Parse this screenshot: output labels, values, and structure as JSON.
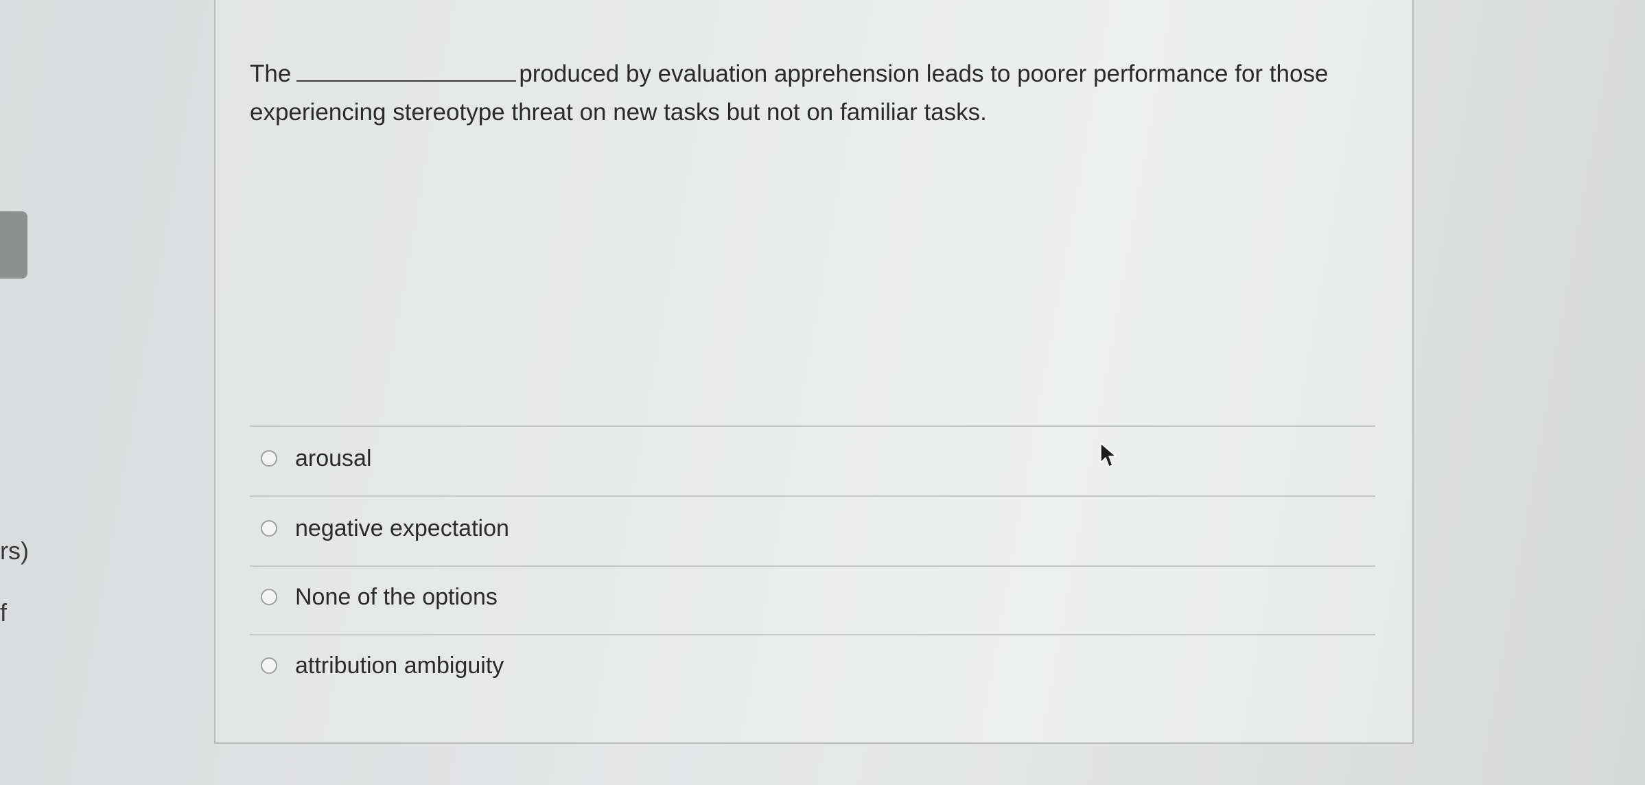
{
  "left_panel": {
    "fragment_1": "rs)",
    "fragment_2": "f"
  },
  "question": {
    "text_before_blank": "The",
    "text_after_blank": "produced by evaluation apprehension leads to poorer performance for those experiencing stereotype threat on new tasks but not on familiar tasks."
  },
  "options": [
    {
      "label": "arousal",
      "selected": false
    },
    {
      "label": "negative expectation",
      "selected": false
    },
    {
      "label": "None of the options",
      "selected": false
    },
    {
      "label": "attribution ambiguity",
      "selected": false
    }
  ],
  "icons": {
    "cursor": "mouse-pointer-icon",
    "radio": "radio-unchecked-icon"
  },
  "colors": {
    "background": "#e1e2e3",
    "card_background": "#e9eaea",
    "card_border": "#b9baba",
    "text": "#2b2b2b",
    "divider": "#c6c7c7",
    "left_tab": "#8e9090"
  }
}
